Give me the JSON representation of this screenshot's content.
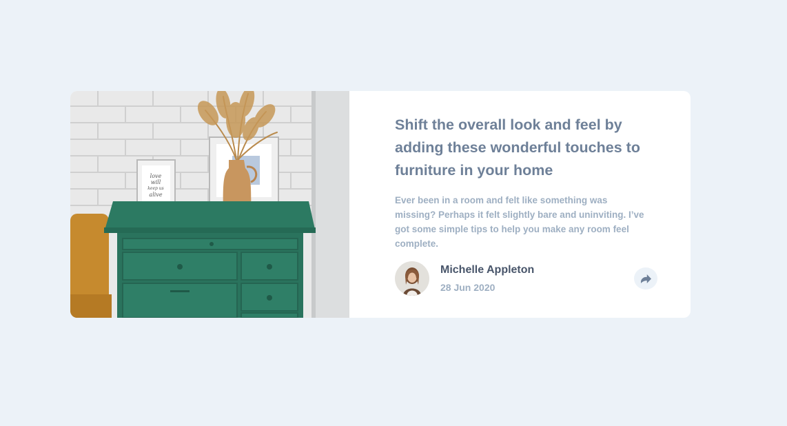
{
  "article": {
    "title": "Shift the overall look and feel by adding these wonderful touches to furniture in your home",
    "excerpt": "Ever been in a room and felt like something was missing? Perhaps it felt slightly bare and uninviting. I’ve got some simple tips to help you make any room feel complete."
  },
  "photo": {
    "frame_text": "love will keep us alive"
  },
  "author": {
    "name": "Michelle Appleton",
    "date": "28 Jun 2020"
  },
  "share": {
    "icon": "share-arrow-icon"
  },
  "colors": {
    "page_background": "#ecf2f8",
    "card_background": "#ffffff",
    "title": "#6e8098",
    "excerpt": "#9eafc2",
    "author_name": "#48556a",
    "share_button": "#ecf2f8",
    "dresser": "#2c7a62"
  }
}
